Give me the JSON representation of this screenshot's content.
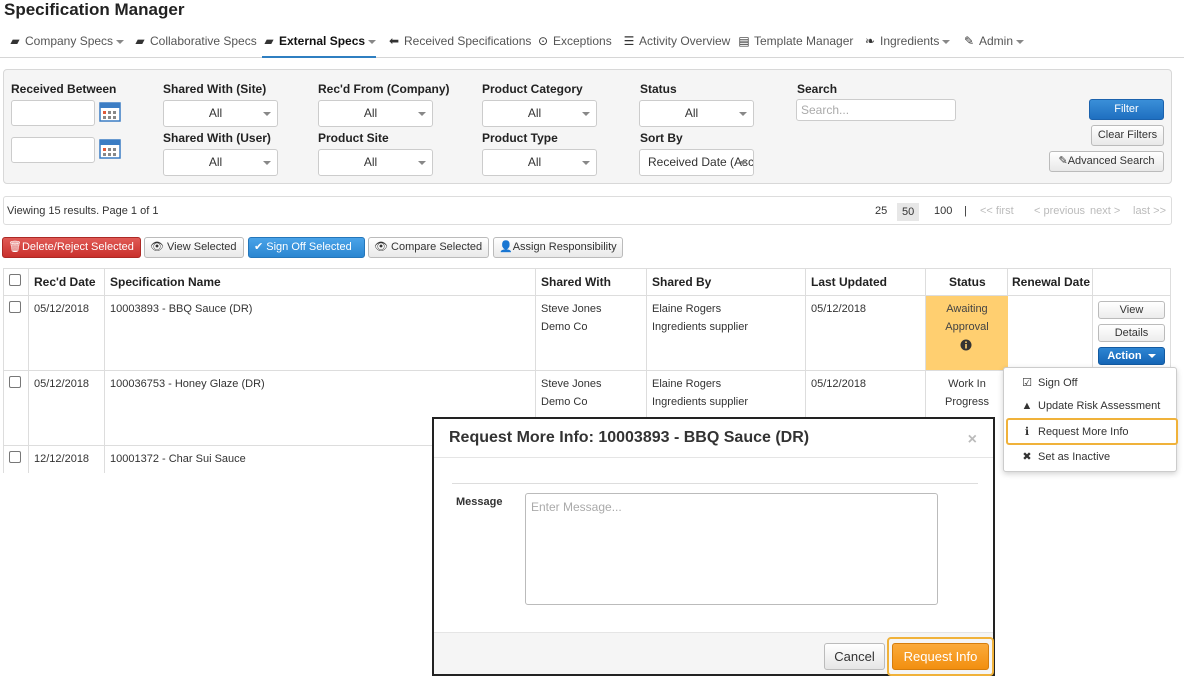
{
  "app": {
    "title": "Specification Manager"
  },
  "nav": {
    "items": [
      {
        "label": "Company Specs",
        "icon": "briefcase-icon",
        "glyph": "💼",
        "dropdown": true,
        "active": false
      },
      {
        "label": "Collaborative Specs",
        "icon": "briefcase-icon",
        "glyph": "💼",
        "dropdown": false,
        "active": false
      },
      {
        "label": "External Specs",
        "icon": "briefcase-icon",
        "glyph": "💼",
        "dropdown": true,
        "active": true
      },
      {
        "label": "Received Specifications",
        "icon": "arrow-left-icon",
        "glyph": "⬅",
        "dropdown": false,
        "active": false
      },
      {
        "label": "Exceptions",
        "icon": "check-circle-icon",
        "glyph": "⊙",
        "dropdown": false,
        "active": false
      },
      {
        "label": "Activity Overview",
        "icon": "list-icon",
        "glyph": "☰",
        "dropdown": false,
        "active": false
      },
      {
        "label": "Template Manager",
        "icon": "document-icon",
        "glyph": "▤",
        "dropdown": false,
        "active": false
      },
      {
        "label": "Ingredients",
        "icon": "leaf-icon",
        "glyph": "❧",
        "dropdown": true,
        "active": false
      },
      {
        "label": "Admin",
        "icon": "wrench-icon",
        "glyph": "🔧",
        "dropdown": true,
        "active": false
      }
    ]
  },
  "filters": {
    "received_between": {
      "label": "Received Between",
      "from_value": "",
      "to_value": ""
    },
    "shared_with_site": {
      "label": "Shared With (Site)",
      "value": "All"
    },
    "shared_with_user": {
      "label": "Shared With (User)",
      "value": "All"
    },
    "recd_from_company": {
      "label": "Rec'd From (Company)",
      "value": "All"
    },
    "product_site": {
      "label": "Product Site",
      "value": "All"
    },
    "product_category": {
      "label": "Product Category",
      "value": "All"
    },
    "product_type": {
      "label": "Product Type",
      "value": "All"
    },
    "status": {
      "label": "Status",
      "value": "All"
    },
    "sort_by": {
      "label": "Sort By",
      "value": "Received Date (Asc"
    },
    "search": {
      "label": "Search",
      "placeholder": "Search..."
    },
    "filter_button": "Filter",
    "clear_button": "Clear Filters",
    "advanced_button": "Advanced Search"
  },
  "results": {
    "summary": "Viewing 15 results. Page 1 of 1",
    "page_sizes": [
      "25",
      "50",
      "100"
    ],
    "active_page_size": "50",
    "separator": "|",
    "first": "<< first",
    "previous": "< previous",
    "next": "next >",
    "last": "last >>"
  },
  "bulk_actions": {
    "delete": "Delete/Reject Selected",
    "view": "View Selected",
    "sign_off": "Sign Off Selected",
    "compare": "Compare Selected",
    "assign": "Assign Responsibility"
  },
  "table": {
    "headers": [
      "Rec'd Date",
      "Specification Name",
      "Shared With",
      "Shared By",
      "Last Updated",
      "Status",
      "Renewal Date"
    ],
    "rows": [
      {
        "recd_date": "05/12/2018",
        "spec_name": "10003893 - BBQ Sauce (DR)",
        "shared_with_1": "Steve Jones",
        "shared_with_2": "Demo Co",
        "shared_by_1": "Elaine Rogers",
        "shared_by_2": "Ingredients supplier",
        "last_updated": "05/12/2018",
        "status_1": "Awaiting",
        "status_2": "Approval",
        "renewal_date": ""
      },
      {
        "recd_date": "05/12/2018",
        "spec_name": "100036753 - Honey Glaze (DR)",
        "shared_with_1": "Steve Jones",
        "shared_with_2": "Demo Co",
        "shared_by_1": "Elaine Rogers",
        "shared_by_2": "Ingredients supplier",
        "last_updated": "05/12/2018",
        "status_1": "Work In",
        "status_2": "Progress",
        "renewal_date": ""
      },
      {
        "recd_date": "12/12/2018",
        "spec_name": "10001372 - Char Sui Sauce"
      }
    ],
    "row_buttons": {
      "view": "View",
      "details": "Details",
      "action": "Action"
    }
  },
  "action_menu": {
    "items": [
      {
        "label": "Sign Off",
        "icon": "checkbox-icon",
        "glyph": "☑"
      },
      {
        "label": "Update Risk Assessment",
        "icon": "warning-icon",
        "glyph": "▲"
      },
      {
        "label": "Request More Info",
        "icon": "info-icon",
        "glyph": "ℹ"
      },
      {
        "label": "Set as Inactive",
        "icon": "close-icon",
        "glyph": "✖"
      }
    ]
  },
  "modal": {
    "title": "Request More Info: 10003893 - BBQ Sauce (DR)",
    "close": "×",
    "message_label": "Message",
    "message_placeholder": "Enter Message...",
    "cancel": "Cancel",
    "submit": "Request Info"
  },
  "colors": {
    "accent": "#2f7fc1",
    "awaiting": "#ffcf70",
    "highlight": "#f0b23a",
    "danger": "#c9302c",
    "primary_btn": "#f28f10"
  }
}
